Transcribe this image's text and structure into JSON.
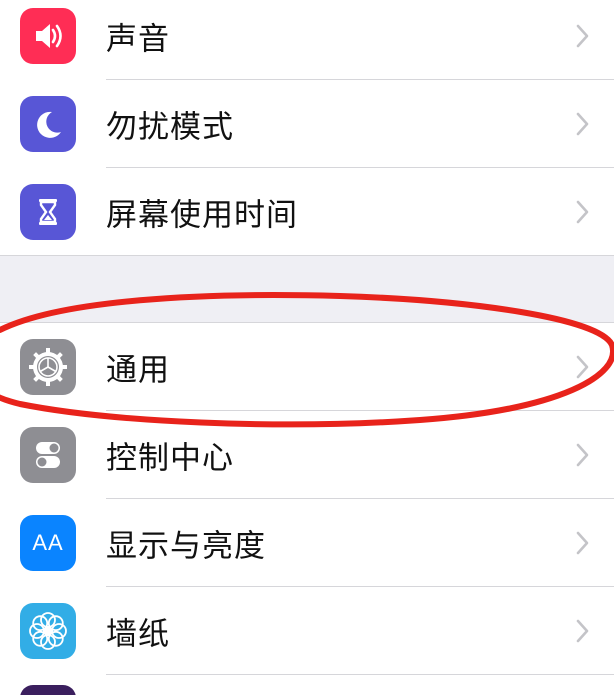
{
  "colors": {
    "sounds": "#ff2d55",
    "dnd": "#5856d6",
    "screen_time": "#5856d6",
    "general": "#8e8e93",
    "control_center": "#8e8e93",
    "display": "#0a84ff",
    "wallpaper": "#32ade6",
    "annotation": "#e8231b",
    "group_gap": "#efeff4"
  },
  "settings": {
    "items": [
      {
        "id": "sounds",
        "label": "声音",
        "icon": "speaker-icon"
      },
      {
        "id": "dnd",
        "label": "勿扰模式",
        "icon": "moon-icon"
      },
      {
        "id": "screen_time",
        "label": "屏幕使用时间",
        "icon": "hourglass-icon"
      },
      {
        "id": "general",
        "label": "通用",
        "icon": "gear-icon"
      },
      {
        "id": "control_center",
        "label": "控制中心",
        "icon": "toggles-icon"
      },
      {
        "id": "display",
        "label": "显示与亮度",
        "icon": "text-size-icon"
      },
      {
        "id": "wallpaper",
        "label": "墙纸",
        "icon": "flower-icon"
      }
    ],
    "display_icon_text": "AA"
  }
}
